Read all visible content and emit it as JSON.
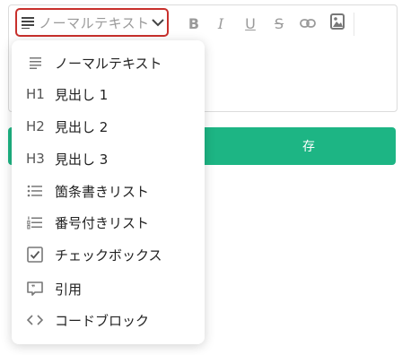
{
  "toolbar": {
    "format_select": {
      "value": "ノーマルテキスト",
      "icon": "paragraph-lines-icon"
    },
    "bold": "B",
    "italic": "I",
    "underline": "U",
    "strikethrough": "S"
  },
  "save_button": {
    "label": "存"
  },
  "menu": {
    "items": [
      {
        "icon": "paragraph-lines-icon",
        "label": "ノーマルテキスト"
      },
      {
        "tag": "H1",
        "label": "見出し 1"
      },
      {
        "tag": "H2",
        "label": "見出し 2"
      },
      {
        "tag": "H3",
        "label": "見出し 3"
      },
      {
        "icon": "bullet-list-icon",
        "label": "箇条書きリスト"
      },
      {
        "icon": "numbered-list-icon",
        "label": "番号付きリスト"
      },
      {
        "icon": "checkbox-icon",
        "label": "チェックボックス"
      },
      {
        "icon": "quote-bubble-icon",
        "label": "引用"
      },
      {
        "icon": "code-brackets-icon",
        "label": "コードブロック"
      }
    ]
  },
  "colors": {
    "accent_red": "#c8302c",
    "save_green": "#1db584"
  }
}
